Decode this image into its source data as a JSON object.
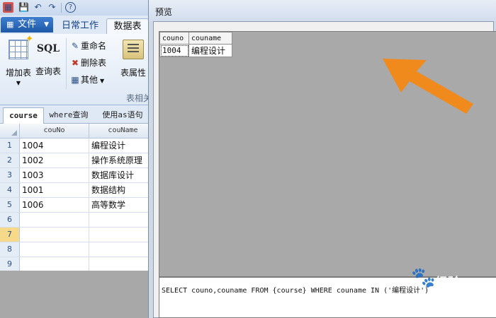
{
  "file_tab": {
    "label": "文件"
  },
  "ribbon_tabs": [
    "日常工作",
    "数据表"
  ],
  "ribbon": {
    "add_table": "增加表",
    "query_table": "查询表",
    "sql_icon_text": "SQL",
    "rename": "重命名",
    "delete_table": "删除表",
    "other": "其他",
    "table_props": "表属性",
    "group_label": "表相关"
  },
  "doc_tabs": [
    "course",
    "where查询",
    "使用as语句"
  ],
  "grid": {
    "columns": [
      "couNo",
      "couName"
    ],
    "rows": [
      {
        "num": "1",
        "couNo": "1004",
        "couName": "编程设计"
      },
      {
        "num": "2",
        "couNo": "1002",
        "couName": "操作系统原理"
      },
      {
        "num": "3",
        "couNo": "1003",
        "couName": "数据库设计"
      },
      {
        "num": "4",
        "couNo": "1001",
        "couName": "数据结构"
      },
      {
        "num": "5",
        "couNo": "1006",
        "couName": "高等数学"
      },
      {
        "num": "6",
        "couNo": "",
        "couName": ""
      },
      {
        "num": "7",
        "couNo": "",
        "couName": ""
      },
      {
        "num": "8",
        "couNo": "",
        "couName": ""
      },
      {
        "num": "9",
        "couNo": "",
        "couName": ""
      }
    ],
    "selected_row": "7"
  },
  "preview": {
    "title": "预览",
    "result_columns": [
      "couno",
      "couname"
    ],
    "result_rows": [
      {
        "couno": "1004",
        "couname": "编程设计"
      }
    ],
    "sql": "SELECT couno,couname FROM {course} WHERE couname IN ('编程设计')"
  },
  "watermark": {
    "text": "经验",
    "sub": "jingyan.baidu.com"
  },
  "colors": {
    "arrow": "#f08a1c",
    "file_tab": "#2a66b8",
    "selected_row_marker": "#f7d98a"
  }
}
